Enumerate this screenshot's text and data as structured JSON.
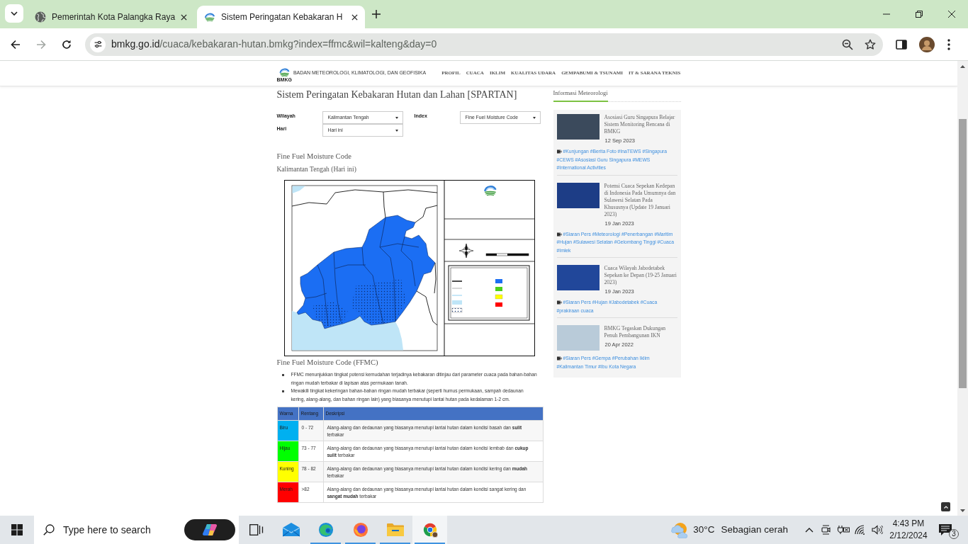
{
  "browser": {
    "tabs": [
      {
        "title": "Pemerintah Kota Palangka Raya",
        "selected": false
      },
      {
        "title": "Sistem Peringatan Kebakaran H",
        "selected": true
      }
    ],
    "forward_disabled": true,
    "url": {
      "host": "bmkg.go.id",
      "path": "/cuaca/kebakaran-hutan.bmkg?index=ffmc&wil=kalteng&day=0"
    }
  },
  "site_header": {
    "logo_text": "BMKG",
    "org_name": "BADAN METEOROLOGI, KLIMATOLOGI, DAN GEOFISIKA",
    "nav": [
      "PROFIL",
      "CUACA",
      "IKLIM",
      "KUALITAS UDARA",
      "GEMPABUMI & TSUNAMI",
      "IT & SARANA TEKNIS"
    ]
  },
  "main": {
    "title": "Sistem Peringatan Kebakaran Hutan dan Lahan [SPARTAN]",
    "filters": [
      {
        "label": "Wilayah",
        "value": "Kalimantan Tengah"
      },
      {
        "label": "Hari",
        "value": "Hari ini"
      },
      {
        "label": "Index",
        "value": "Fine Fuel Moisture Code"
      }
    ],
    "section_title": "Fine Fuel Moisture Code",
    "subtitle": "Kalimantan Tengah (Hari ini)",
    "description_title": "Fine Fuel Moisture Code (FFMC)",
    "bullets": [
      "FFMC menunjukkan tingkat potensi kemudahan terjadinya kebakaran ditinjau dari parameter cuaca pada bahan-bahan ringan mudah terbakar di lapisan atas permukaan tanah.",
      "Mewakili tingkat kekeringan bahan-bahan ringan mudah terbakar (seperti humus permukaan, sampah dedaunan kering, alang-alang, dan bahan ringan lain) yang biasanya menutupi lantai hutan pada kedalaman 1-2 cm."
    ],
    "table": {
      "columns": [
        "Warna",
        "Rentang",
        "Deskripsi"
      ],
      "rows": [
        {
          "color_name": "Biru",
          "color": "#00b0f0",
          "range": "0 - 72",
          "description": "Alang-alang dan dedaunan yang biasanya menutupi lantai hutan dalam kondisi basah dan **sulit** terbakar"
        },
        {
          "color_name": "Hijau",
          "color": "#00ff00",
          "range": "73 - 77",
          "description": "Alang-alang dan dedaunan yang biasanya menutupi lantai hutan dalam kondisi lembab dan **cukup sulit** terbakar"
        },
        {
          "color_name": "Kuning",
          "color": "#ffff00",
          "range": "78 - 82",
          "description": "Alang-alang dan dedaunan yang biasanya menutupi lantai hutan dalam kondisi kering dan **mudah** terbakar"
        },
        {
          "color_name": "Merah",
          "color": "#ff0000",
          "range": ">82",
          "description": "Alang-alang dan dedaunan yang biasanya menutupi lantai hutan dalam kondisi sangat kering dan **sangat mudah** terbakar"
        }
      ]
    }
  },
  "sidebar": {
    "title": "Informasi Meteorologi",
    "articles": [
      {
        "title": "Asosiasi Guru Singapura Belajar Sistem Monitoring Bencana di BMKG",
        "date": "12 Sep 2023",
        "tags": [
          "#Kunjungan",
          "#Berita Foto",
          "#InaTEWS",
          "#Singapura",
          "#CEWS",
          "#Asosiasi Guru Singapura",
          "#MEWS",
          "#International Activities"
        ]
      },
      {
        "title": "Potensi Cuaca Sepekan Kedepan di Indonesia Pada Umumnya dan Sulawesi Selatan Pada Khususnya (Update 19 Januari 2023)",
        "date": "19 Jan 2023",
        "tags": [
          "#Siaran Pers",
          "#Meteorologi",
          "#Penerbangan",
          "#Maritim",
          "#Hujan",
          "#Sulawesi Selatan",
          "#Gelombang Tinggi",
          "#Cuaca",
          "#Imlek"
        ]
      },
      {
        "title": "Cuaca Wilayah Jabodetabek Sepekan ke Depan (19-25 Januari 2023)",
        "date": "19 Jan 2023",
        "tags": [
          "#Siaran Pers",
          "#Hujan",
          "#Jabodetabek",
          "#Cuaca",
          "#prakiraan cuaca"
        ]
      },
      {
        "title": "BMKG Tegaskan Dukungan Penuh Pembangunan IKN",
        "date": "20 Apr 2022",
        "tags": [
          "#Siaran Pers",
          "#Gempa",
          "#Perubahan Iklim",
          "#Kalimantan Timur",
          "#Ibu Kota Negara"
        ]
      }
    ]
  },
  "taskbar": {
    "search": {
      "placeholder": "Type here to search"
    },
    "apps": [
      {
        "kind": "task-view",
        "running": false,
        "active": false
      },
      {
        "kind": "mail",
        "running": false,
        "active": false
      },
      {
        "kind": "edge",
        "running": true,
        "active": false
      },
      {
        "kind": "firefox",
        "running": true,
        "active": false
      },
      {
        "kind": "files",
        "running": true,
        "active": false
      },
      {
        "kind": "chrome",
        "running": true,
        "active": true
      }
    ],
    "weather": {
      "temperature": "30°C",
      "condition": "Sebagian cerah"
    },
    "clock": {
      "time": "4:43 PM",
      "date": "2/12/2024"
    },
    "notifications": {
      "count": "3"
    }
  }
}
